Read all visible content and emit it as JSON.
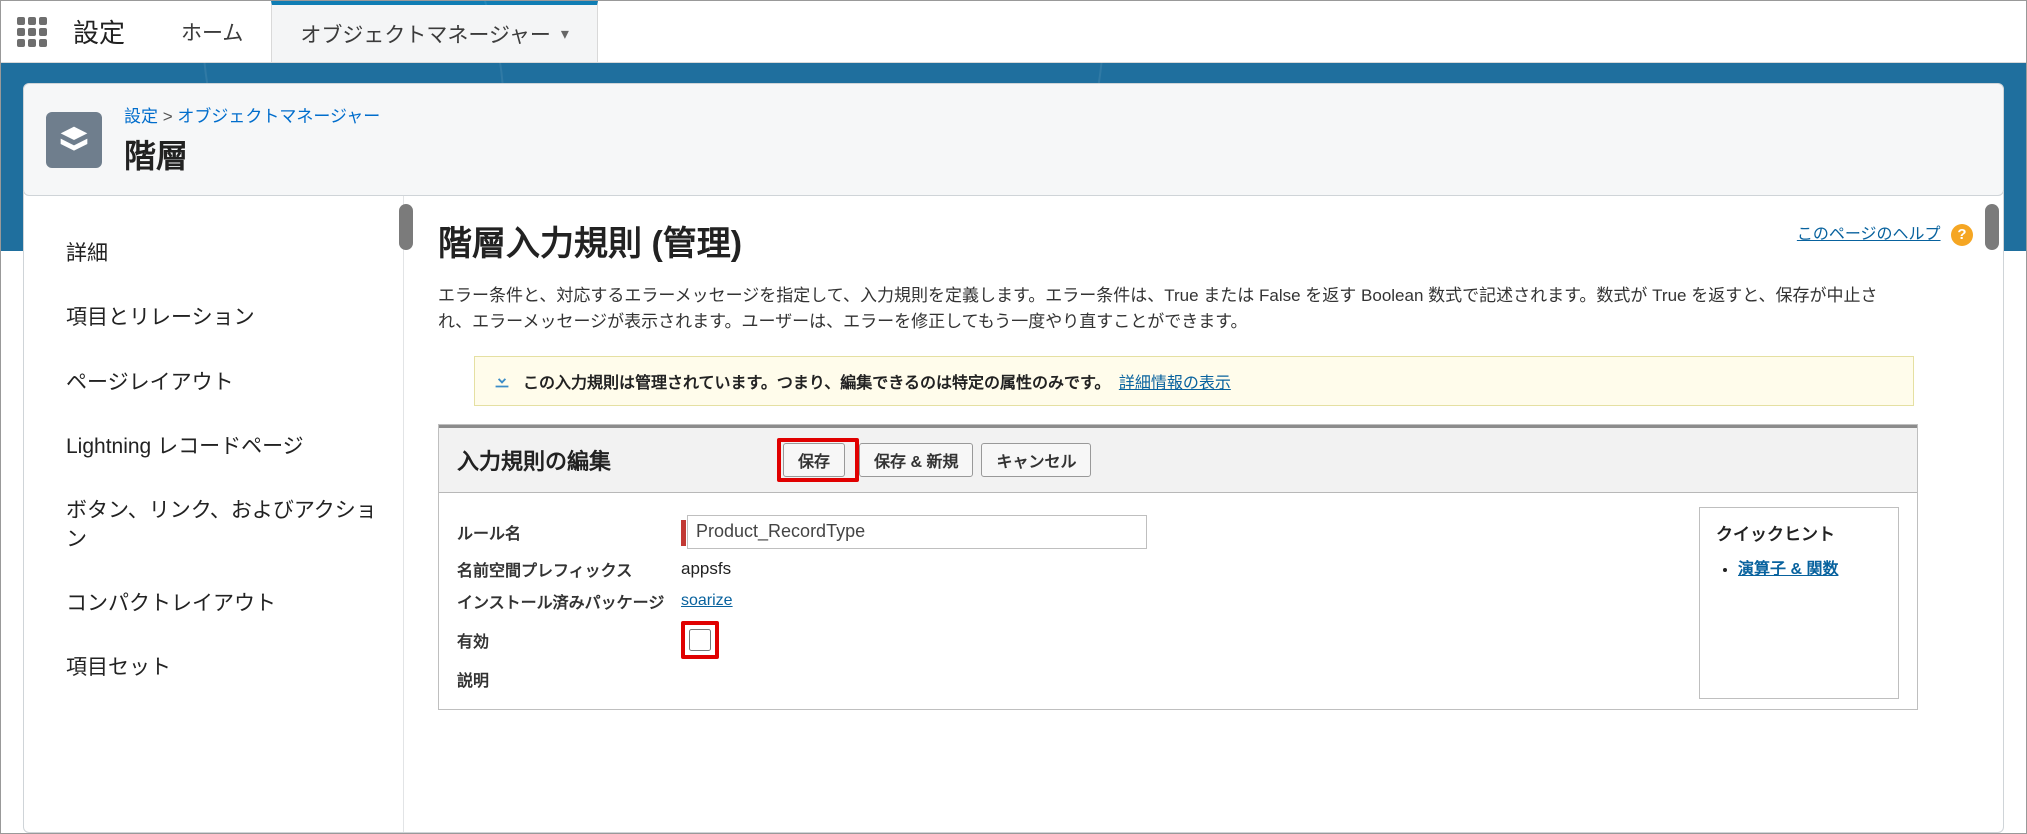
{
  "topnav": {
    "app_title": "設定",
    "tabs": [
      {
        "label": "ホーム"
      },
      {
        "label": "オブジェクトマネージャー"
      }
    ]
  },
  "header": {
    "breadcrumb_root": "設定",
    "breadcrumb_sep": " > ",
    "breadcrumb_current": "オブジェクトマネージャー",
    "title": "階層"
  },
  "sidebar": {
    "items": [
      "詳細",
      "項目とリレーション",
      "ページレイアウト",
      "Lightning レコードページ",
      "ボタン、リンク、およびアクション",
      "コンパクトレイアウト",
      "項目セット"
    ]
  },
  "main": {
    "heading": "階層入力規則 (管理)",
    "help_label": "このページのヘルプ",
    "help_glyph": "?",
    "intro": "エラー条件と、対応するエラーメッセージを指定して、入力規則を定義します。エラー条件は、True または False を返す Boolean 数式で記述されます。数式が True を返すと、保存が中止され、エラーメッセージが表示されます。ユーザーは、エラーを修正してもう一度やり直すことができます。",
    "banner_text": "この入力規則は管理されています。つまり、編集できるのは特定の属性のみです。",
    "banner_link": "詳細情報の表示"
  },
  "panel": {
    "title": "入力規則の編集",
    "buttons": {
      "save": "保存",
      "save_new": "保存 & 新規",
      "cancel": "キャンセル"
    },
    "fields": {
      "rule_name_label": "ルール名",
      "rule_name_value": "Product_RecordType",
      "ns_prefix_label": "名前空間プレフィックス",
      "ns_prefix_value": "appsfs",
      "package_label": "インストール済みパッケージ",
      "package_value": "soarize",
      "active_label": "有効",
      "description_label": "説明"
    },
    "hint": {
      "title": "クイックヒント",
      "link": "演算子 & 関数"
    }
  }
}
